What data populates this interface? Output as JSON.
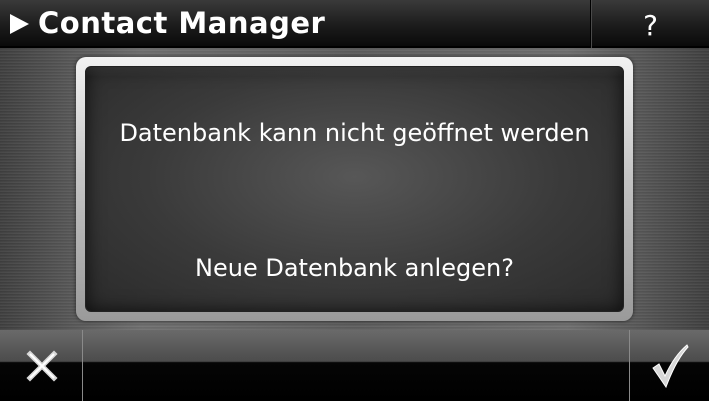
{
  "header": {
    "title": "Contact Manager",
    "help_label": "?"
  },
  "dialog": {
    "message": "Datenbank kann nicht geöffnet werden",
    "question": "Neue Datenbank anlegen?"
  },
  "footer": {
    "cancel_icon": "close-icon",
    "confirm_icon": "checkmark-icon"
  },
  "colors": {
    "text": "#ffffff",
    "header_bg": "#1c1c1c",
    "dialog_bg": "#3a3a3a",
    "footer_bg": "#000000"
  }
}
